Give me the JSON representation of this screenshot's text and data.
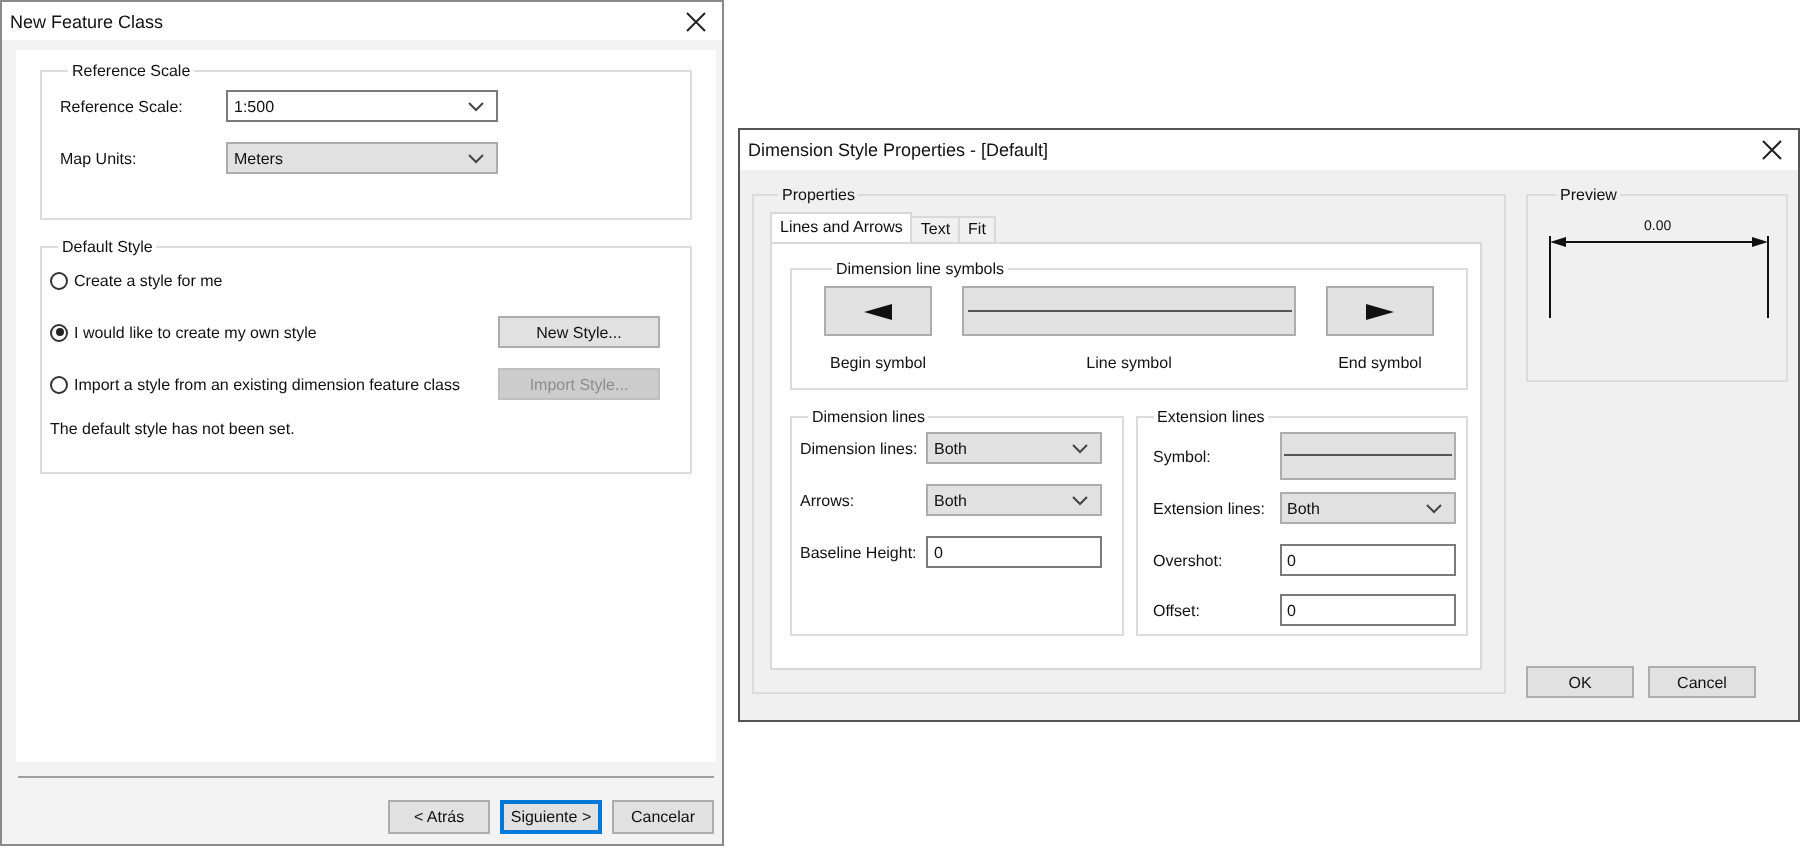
{
  "new_feature_class": {
    "title": "New Feature Class",
    "reference_scale_group": {
      "title": "Reference Scale",
      "fields": [
        {
          "label": "Reference Scale:",
          "value": "1:500",
          "kind": "combo"
        },
        {
          "label": "Map Units:",
          "value": "Meters",
          "kind": "dropdown"
        }
      ]
    },
    "default_style_group": {
      "title": "Default Style",
      "options": [
        {
          "label": "Create a style for me",
          "selected": false
        },
        {
          "label": "I would like to create my own style",
          "selected": true,
          "button": {
            "label": "New Style...",
            "disabled": false
          }
        },
        {
          "label": "Import a style from an existing dimension feature class",
          "selected": false,
          "button": {
            "label": "Import Style...",
            "disabled": true
          }
        }
      ],
      "note": "The default style has not been set."
    },
    "buttons": [
      {
        "label": "< Atrás",
        "focused": false
      },
      {
        "label": "Siguiente >",
        "focused": true
      },
      {
        "label": "Cancelar",
        "focused": false
      }
    ]
  },
  "dimension_style": {
    "title": "Dimension Style Properties - [Default]",
    "properties_group": {
      "title": "Properties",
      "tabs": [
        {
          "label": "Lines and Arrows",
          "selected": true
        },
        {
          "label": "Text",
          "selected": false
        },
        {
          "label": "Fit",
          "selected": false
        }
      ],
      "symbols_group": {
        "title": "Dimension line symbols",
        "symbols": [
          {
            "kind": "begin",
            "label": "Begin symbol"
          },
          {
            "kind": "line",
            "label": "Line symbol"
          },
          {
            "kind": "end",
            "label": "End symbol"
          }
        ]
      },
      "dimension_lines_group": {
        "title": "Dimension lines",
        "fields": [
          {
            "label": "Dimension lines:",
            "value": "Both",
            "kind": "dropdown"
          },
          {
            "label": "Arrows:",
            "value": "Both",
            "kind": "dropdown"
          },
          {
            "label": "Baseline Height:",
            "value": "0",
            "kind": "text"
          }
        ]
      },
      "extension_lines_group": {
        "title": "Extension lines",
        "fields": [
          {
            "label": "Symbol:",
            "kind": "symbol"
          },
          {
            "label": "Extension lines:",
            "value": "Both",
            "kind": "dropdown"
          },
          {
            "label": "Overshot:",
            "value": "0",
            "kind": "text"
          },
          {
            "label": "Offset:",
            "value": "0",
            "kind": "text"
          }
        ]
      }
    },
    "preview": {
      "title": "Preview",
      "value": "0.00"
    },
    "buttons": [
      {
        "label": "OK",
        "focused": false
      },
      {
        "label": "Cancel",
        "focused": false
      }
    ]
  }
}
